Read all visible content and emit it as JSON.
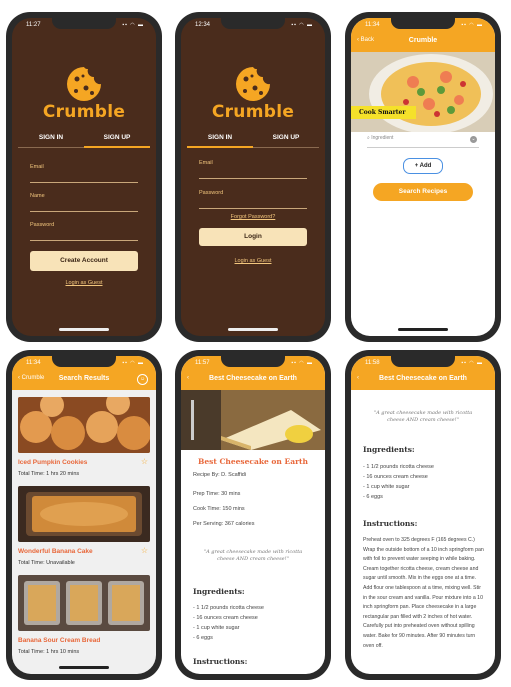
{
  "signup": {
    "time": "11:27",
    "logo": "Crumble",
    "tab_signin": "SIGN IN",
    "tab_signup": "SIGN UP",
    "email_label": "Email",
    "name_label": "Name",
    "password_label": "Password",
    "create_button": "Create Account",
    "guest_link": "Login as Guest"
  },
  "signin": {
    "time": "12:34",
    "logo": "Crumble",
    "tab_signin": "SIGN IN",
    "tab_signup": "SIGN UP",
    "email_label": "Email",
    "password_label": "Password",
    "forgot_link": "Forgot Password?",
    "login_button": "Login",
    "guest_link": "Login as Guest"
  },
  "search": {
    "time": "11:34",
    "back": "Back",
    "title": "Crumble",
    "banner": "Cook Smarter",
    "ingredient_placeholder": "Ingredient",
    "add_button": "+ Add",
    "search_button": "Search Recipes"
  },
  "results": {
    "time": "11:34",
    "back": "Crumble",
    "title": "Search Results",
    "items": [
      {
        "name": "Iced Pumpkin Cookies",
        "meta": "Total Time: 1 hrs 20 mins"
      },
      {
        "name": "Wonderful Banana Cake",
        "meta": "Total Time: Unavailable"
      },
      {
        "name": "Banana Sour Cream Bread",
        "meta": "Total Time: 1 hrs 10 mins"
      }
    ]
  },
  "detail": {
    "time": "11:57",
    "title": "Best Cheesecake on Earth",
    "heading": "Best Cheesecake on Earth",
    "by": "Recipe By: D. Scaffidi",
    "prep": "Prep Time: 30 mins",
    "cook": "Cook Time: 150 mins",
    "serving": "Per Serving: 367 calories",
    "quote": "\"A great cheesecake made with ricotta cheese AND cream cheese!\"",
    "ingredients_title": "Ingredients:",
    "ingredients": [
      "- 1 1/2 pounds ricotta cheese",
      "- 16 ounces cream cheese",
      "- 1 cup white sugar",
      "- 6 eggs"
    ],
    "instructions_title": "Instructions:"
  },
  "detail2": {
    "time": "11:58",
    "title": "Best Cheesecake on Earth",
    "quote": "\"A great cheesecake made with ricotta cheese AND cream cheese!\"",
    "ingredients_title": "Ingredients:",
    "ingredients": [
      "- 1 1/2 pounds ricotta cheese",
      "- 16 ounces cream cheese",
      "- 1 cup white sugar",
      "- 6 eggs"
    ],
    "instructions_title": "Instructions:",
    "instructions": "Preheat oven to 325 degrees F (165 degrees C.) Wrap the outside bottom of a 10 inch springform pan with foil to prevent water seeping in while baking. Cream together ricotta cheese, cream cheese and sugar until smooth. Mix in the eggs one at a time. Add flour one tablespoon at a time, mixing well. Stir in the sour cream and vanilla. Pour mixture into a 10 inch springform pan. Place cheesecake in a large rectangular pan filled with 2 inches of hot water. Carefully put into preheated oven without spilling water. Bake for 90 minutes. After 90 minutes turn oven off."
  },
  "colors": {
    "brown": "#4a2c1c",
    "orange": "#f5a623",
    "cream": "#f8e3b8",
    "red": "#e8673a"
  }
}
